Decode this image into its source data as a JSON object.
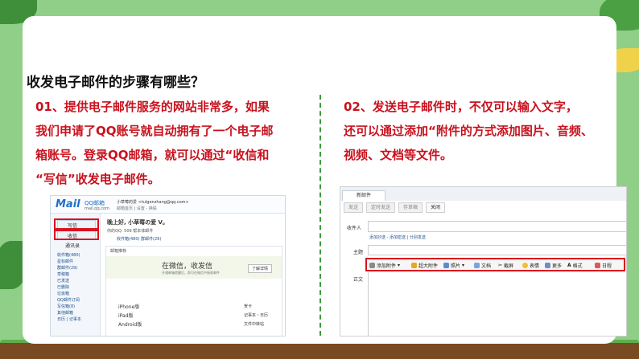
{
  "heading": "收发电子邮件的步骤有哪些？",
  "left_paragraph": [
    "01、提供电子邮件服务的网站非常多，如果",
    "我们申请了QQ账号就自动拥有了一个电子邮",
    "箱账号。登录QQ邮箱，就可以通过“收信和",
    "“写信”收发电子邮件。"
  ],
  "right_paragraph": [
    "02、发送电子邮件时，不仅可以输入文字，",
    "还可以通过添加“附件的方式添加图片、音频、",
    "视频、文档等文件。"
  ],
  "qqmail": {
    "logo": "Mail",
    "brand": "QQ邮箱",
    "domain": "mail.qq.com",
    "user_line": "小草莓的爱 <tulgenzhang@qq.com>",
    "user_sub": "邮箱首页 | 设置 - 换肤",
    "compose": "写信",
    "inbox": "收信",
    "contacts": "通讯录",
    "greeting": "晚上好, 小草莓の爱 V。",
    "vip_line": "你的QQ: 509 帮本体邮件",
    "counts": "收件箱(480)  群邮件(29)",
    "folders": [
      "收件箱(480)",
      "星标邮件",
      "群邮件(29)",
      "草稿箱",
      "已发送",
      "已删除",
      "垃圾箱",
      "QQ邮件订阅",
      "写信箱(8)"
    ],
    "extra": [
      "日历 | 记事本",
      "其他邮箱"
    ],
    "promo_header": "邮箱推荐",
    "promo_title": "在微信，收发信",
    "promo_sub": "开通邮箱提醒后，即可在微信中接收邮件",
    "promo_btn": "了解详情",
    "apps": [
      "iPhone版",
      "iPad版",
      "Android版"
    ],
    "apps_right": [
      "贺卡",
      "记事本・日历",
      "文件中转站"
    ]
  },
  "compose": {
    "tab": "新邮件",
    "buttons": [
      "发送",
      "定时发送",
      "存草稿",
      "关闭"
    ],
    "to_label": "收件人",
    "cc_links": "添加抄送 - 添加密送 | 分别发送",
    "subject_label": "主题",
    "body_label": "正文",
    "toolbar": [
      "添加附件",
      "超大附件",
      "照片",
      "文档",
      "截屏",
      "表情",
      "更多",
      "格式",
      "日程"
    ]
  }
}
